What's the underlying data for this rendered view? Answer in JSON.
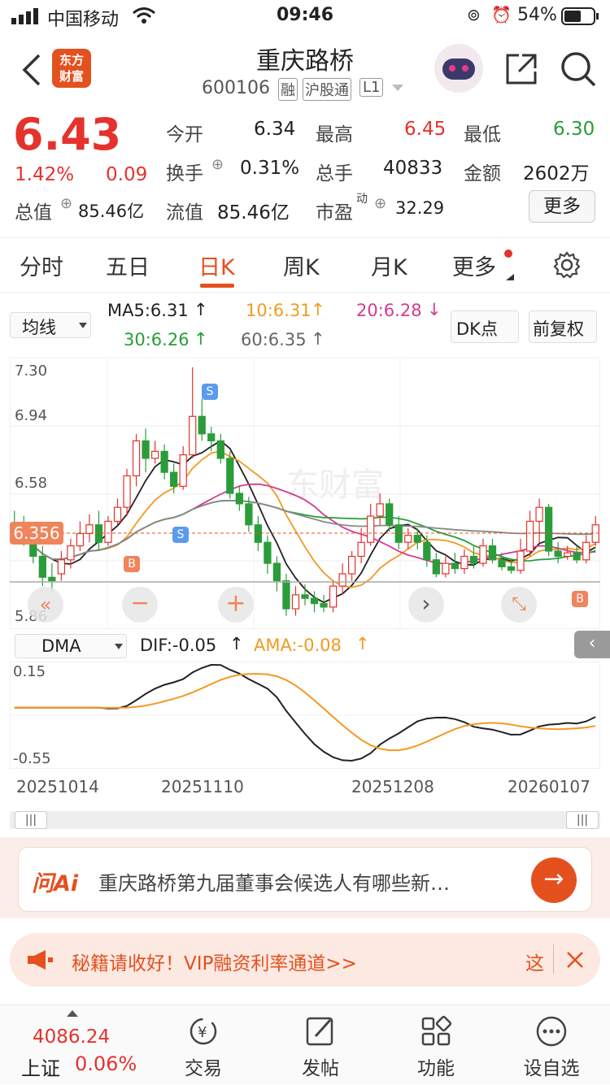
{
  "status": {
    "carrier": "中国移动",
    "time": "09:46",
    "battery": "54%"
  },
  "header": {
    "logo_line1": "东方",
    "logo_line2": "财富",
    "title": "重庆路桥",
    "code": "600106",
    "badge1": "融",
    "badge2": "沪股通",
    "badge3": "L1"
  },
  "quote": {
    "price": "6.43",
    "change_pct": "1.42%",
    "change_amt": "0.09",
    "items": [
      {
        "label": "今开",
        "value": "6.34"
      },
      {
        "label": "最高",
        "value": "6.45"
      },
      {
        "label": "最低",
        "value": "6.30"
      },
      {
        "label": "换手",
        "value": "0.31%"
      },
      {
        "label": "总手",
        "value": "40833"
      },
      {
        "label": "金额",
        "value": "2602万"
      },
      {
        "label": "流值",
        "value": "85.46亿"
      },
      {
        "label": "市盈",
        "value": "32.29"
      }
    ],
    "total_label": "总值",
    "total_value": "85.46亿",
    "pe_sup": "动",
    "more": "更多"
  },
  "tabs": [
    "分时",
    "五日",
    "日K",
    "周K",
    "月K",
    "更多"
  ],
  "ma": {
    "selector": "均线",
    "ma5": "MA5:6.31",
    "ma10": "10:6.31",
    "ma20": "20:6.28",
    "ma30": "30:6.26",
    "ma60": "60:6.35",
    "dk": "DK点",
    "fq": "前复权"
  },
  "chart": {
    "y_labels": [
      "7.30",
      "6.94",
      "6.58",
      "5.86"
    ],
    "price_tag": "6.356",
    "s_label": "S",
    "b_label": "B"
  },
  "dma": {
    "selector": "DMA",
    "dif": "DIF:-0.05",
    "ama": "AMA:-0.08",
    "top": "0.15",
    "bottom": "-0.55"
  },
  "dates": [
    "20251014",
    "20251110",
    "20251208",
    "20260107"
  ],
  "ai": {
    "logo": "问Ai",
    "text": "重庆路桥第九届董事会候选人有哪些新…"
  },
  "notice": {
    "text": "融资利率通道>>",
    "prefix": "秘籍请收好！VIP",
    "tail": "这"
  },
  "bottom": {
    "index_value": "4086.24",
    "index_name": "上证",
    "index_pct": "0.06%",
    "items": [
      "交易",
      "发帖",
      "功能",
      "设自选"
    ]
  },
  "colors": {
    "up": "#e5322d",
    "down": "#2a9d3a",
    "accent": "#f29a1f"
  },
  "chart_data": {
    "type": "candlestick",
    "ylim": [
      5.86,
      7.3
    ],
    "candles": [
      [
        6.4,
        6.32,
        6.48,
        6.3
      ],
      [
        6.38,
        6.3,
        6.45,
        6.28
      ],
      [
        6.3,
        6.22,
        6.36,
        6.18
      ],
      [
        6.22,
        6.1,
        6.28,
        6.05
      ],
      [
        6.1,
        6.08,
        6.18,
        6.02
      ],
      [
        6.12,
        6.2,
        6.25,
        6.08
      ],
      [
        6.2,
        6.28,
        6.32,
        6.15
      ],
      [
        6.28,
        6.35,
        6.42,
        6.25
      ],
      [
        6.35,
        6.4,
        6.46,
        6.3
      ],
      [
        6.4,
        6.3,
        6.48,
        6.25
      ],
      [
        6.3,
        6.42,
        6.45,
        6.28
      ],
      [
        6.42,
        6.5,
        6.55,
        6.4
      ],
      [
        6.5,
        6.68,
        6.72,
        6.45
      ],
      [
        6.68,
        6.88,
        6.92,
        6.62
      ],
      [
        6.88,
        6.78,
        6.95,
        6.7
      ],
      [
        6.78,
        6.82,
        6.88,
        6.75
      ],
      [
        6.82,
        6.7,
        6.86,
        6.66
      ],
      [
        6.7,
        6.62,
        6.75,
        6.58
      ],
      [
        6.62,
        6.8,
        6.85,
        6.6
      ],
      [
        6.8,
        7.02,
        7.3,
        6.78
      ],
      [
        7.02,
        6.92,
        7.12,
        6.88
      ],
      [
        6.92,
        6.88,
        6.96,
        6.82
      ],
      [
        6.88,
        6.78,
        6.92,
        6.75
      ],
      [
        6.78,
        6.58,
        6.82,
        6.55
      ],
      [
        6.58,
        6.52,
        6.62,
        6.48
      ],
      [
        6.52,
        6.4,
        6.56,
        6.36
      ],
      [
        6.4,
        6.3,
        6.45,
        6.25
      ],
      [
        6.3,
        6.18,
        6.34,
        6.12
      ],
      [
        6.18,
        6.08,
        6.22,
        6.02
      ],
      [
        6.08,
        5.92,
        6.12,
        5.88
      ],
      [
        5.92,
        6.0,
        6.05,
        5.88
      ],
      [
        6.0,
        5.98,
        6.06,
        5.94
      ],
      [
        5.98,
        5.95,
        6.02,
        5.9
      ],
      [
        5.95,
        5.93,
        6.0,
        5.9
      ],
      [
        5.93,
        6.05,
        6.08,
        5.9
      ],
      [
        6.05,
        6.12,
        6.18,
        6.0
      ],
      [
        6.12,
        6.22,
        6.25,
        6.08
      ],
      [
        6.22,
        6.3,
        6.38,
        6.18
      ],
      [
        6.3,
        6.45,
        6.52,
        6.28
      ],
      [
        6.45,
        6.52,
        6.58,
        6.4
      ],
      [
        6.52,
        6.4,
        6.55,
        6.36
      ],
      [
        6.4,
        6.3,
        6.45,
        6.26
      ],
      [
        6.3,
        6.34,
        6.38,
        6.26
      ],
      [
        6.34,
        6.3,
        6.38,
        6.26
      ],
      [
        6.3,
        6.2,
        6.34,
        6.16
      ],
      [
        6.2,
        6.12,
        6.24,
        6.1
      ],
      [
        6.12,
        6.18,
        6.22,
        6.1
      ],
      [
        6.18,
        6.15,
        6.24,
        6.12
      ],
      [
        6.15,
        6.22,
        6.26,
        6.12
      ],
      [
        6.22,
        6.18,
        6.28,
        6.15
      ],
      [
        6.18,
        6.28,
        6.32,
        6.16
      ],
      [
        6.28,
        6.2,
        6.32,
        6.18
      ],
      [
        6.2,
        6.16,
        6.24,
        6.14
      ],
      [
        6.16,
        6.14,
        6.2,
        6.12
      ],
      [
        6.14,
        6.25,
        6.32,
        6.12
      ],
      [
        6.25,
        6.42,
        6.48,
        6.22
      ],
      [
        6.42,
        6.5,
        6.55,
        6.3
      ],
      [
        6.5,
        6.25,
        6.52,
        6.22
      ],
      [
        6.25,
        6.22,
        6.3,
        6.18
      ],
      [
        6.22,
        6.24,
        6.28,
        6.2
      ],
      [
        6.24,
        6.2,
        6.28,
        6.18
      ],
      [
        6.2,
        6.3,
        6.34,
        6.18
      ],
      [
        6.3,
        6.4,
        6.45,
        6.28
      ]
    ]
  }
}
